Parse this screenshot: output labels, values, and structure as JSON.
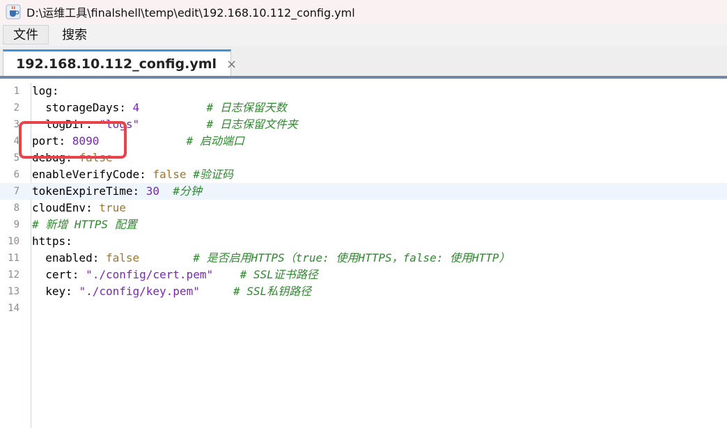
{
  "window": {
    "title": "D:\\运维工具\\finalshell\\temp\\edit\\192.168.10.112_config.yml",
    "icon": "java-cup-icon"
  },
  "menu": [
    {
      "label": "文件",
      "active": true
    },
    {
      "label": "搜索",
      "active": false
    }
  ],
  "tabs": [
    {
      "label": "192.168.10.112_config.yml",
      "close": "×"
    }
  ],
  "editor": {
    "current_line": 7,
    "lines": [
      {
        "n": "1",
        "key": "log:",
        "val": "",
        "comment": ""
      },
      {
        "n": "2",
        "key": "  storageDays: ",
        "val": "4",
        "comment": "          # 日志保留天数"
      },
      {
        "n": "3",
        "key": "  logDir: ",
        "val": "\"logs\"",
        "comment": "          # 日志保留文件夹"
      },
      {
        "n": "4",
        "key": "port: ",
        "val": "8090",
        "comment": "             # 启动端口"
      },
      {
        "n": "5",
        "key": "debug: ",
        "val": "false",
        "comment": ""
      },
      {
        "n": "6",
        "key": "enableVerifyCode: ",
        "val": "false",
        "comment": " #验证码"
      },
      {
        "n": "7",
        "key": "tokenExpireTime: ",
        "val": "30",
        "comment": "  #分钟"
      },
      {
        "n": "8",
        "key": "cloudEnv: ",
        "val": "true",
        "comment": ""
      },
      {
        "n": "9",
        "key": "",
        "val": "",
        "comment": "# 新增 HTTPS 配置"
      },
      {
        "n": "10",
        "key": "https:",
        "val": "",
        "comment": ""
      },
      {
        "n": "11",
        "key": "  enabled: ",
        "val": "false",
        "comment": "        # 是否启用HTTPS（true: 使用HTTPS，false: 使用HTTP）"
      },
      {
        "n": "12",
        "key": "  cert: ",
        "val": "\"./config/cert.pem\"",
        "comment": "    # SSL证书路径"
      },
      {
        "n": "13",
        "key": "  key: ",
        "val": "\"./config/key.pem\"",
        "comment": "     # SSL私钥路径"
      },
      {
        "n": "14",
        "key": "",
        "val": "",
        "comment": ""
      }
    ]
  },
  "colors": {
    "tab_accent": "#3f94d7",
    "highlight_box": "#e8434a",
    "comment": "#2e8b2e",
    "value": "#7a26b8",
    "boolean": "#a0762a"
  }
}
